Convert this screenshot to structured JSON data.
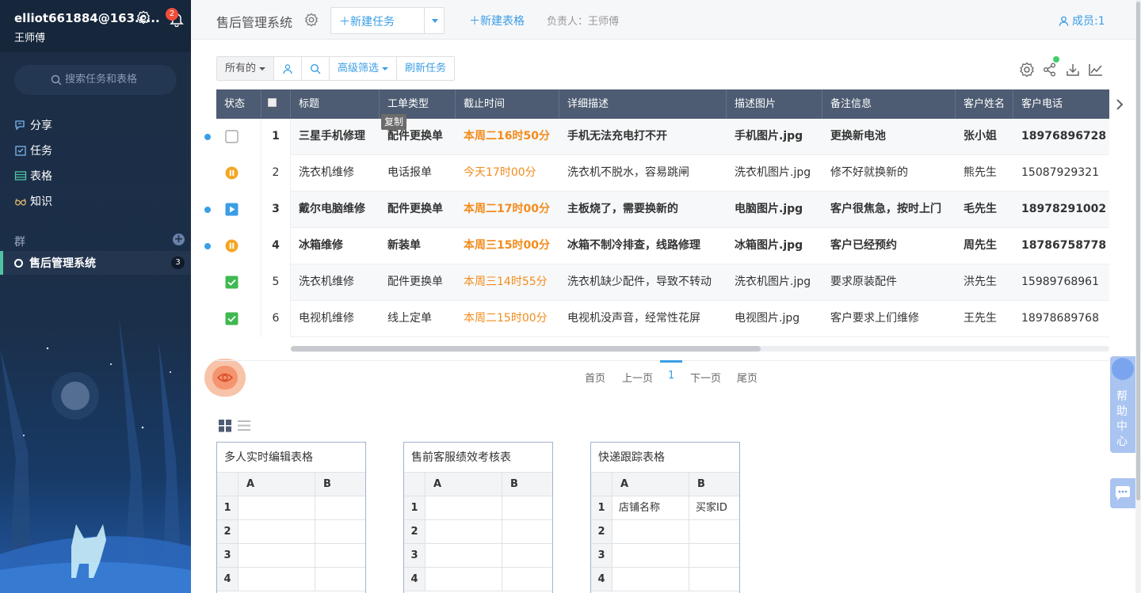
{
  "user": {
    "email": "elliot661884@163.c...",
    "name": "王师傅",
    "notifications": "2"
  },
  "sidebar": {
    "search_placeholder": "搜索任务和表格",
    "nav": [
      {
        "label": "分享",
        "icon": "share-chat-icon"
      },
      {
        "label": "任务",
        "icon": "task-check-icon"
      },
      {
        "label": "表格",
        "icon": "table-icon"
      },
      {
        "label": "知识",
        "icon": "glasses-icon"
      }
    ],
    "group_label": "群",
    "group_item": {
      "label": "售后管理系统",
      "count": "3"
    }
  },
  "header": {
    "title": "售后管理系统",
    "new_task": "新建任务",
    "new_table": "新建表格",
    "owner": "负责人：王师傅",
    "members": "成员:1"
  },
  "filter": {
    "all": "所有的",
    "advanced": "高级筛选",
    "refresh": "刷新任务"
  },
  "table": {
    "columns": [
      "状态",
      "标题",
      "工单类型",
      "截止时间",
      "详细描述",
      "描述图片",
      "备注信息",
      "客户姓名",
      "客户电话"
    ],
    "tooltip": "复制",
    "rows": [
      {
        "num": "1",
        "status": "unchecked",
        "title": "三星手机修理",
        "type": "配件更换单",
        "deadline": "本周二16时50分",
        "desc": "手机无法充电打不开",
        "image": "手机图片.jpg",
        "remark": "更换新电池",
        "customer": "张小姐",
        "phone": "18976896728",
        "bold": true,
        "unread": true
      },
      {
        "num": "2",
        "status": "paused",
        "title": "洗衣机维修",
        "type": "电话报单",
        "deadline": "今天17时00分",
        "desc": "洗衣机不脱水，容易跳闸",
        "image": "洗衣机图片.jpg",
        "remark": "修不好就换新的",
        "customer": "熊先生",
        "phone": "15087929321",
        "bold": false,
        "unread": false
      },
      {
        "num": "3",
        "status": "playing",
        "title": "戴尔电脑维修",
        "type": "配件更换单",
        "deadline": "本周二17时00分",
        "desc": "主板烧了，需要换新的",
        "image": "电脑图片.jpg",
        "remark": "客户很焦急，按时上门",
        "customer": "毛先生",
        "phone": "18978291002",
        "bold": true,
        "unread": true
      },
      {
        "num": "4",
        "status": "paused",
        "title": "冰箱维修",
        "type": "新装单",
        "deadline": "本周三15时00分",
        "desc": "冰箱不制冷排查，线路修理",
        "image": "冰箱图片.jpg",
        "remark": "客户已经预约",
        "customer": "周先生",
        "phone": "18786758778",
        "bold": true,
        "unread": true
      },
      {
        "num": "5",
        "status": "done",
        "title": "洗衣机维修",
        "type": "配件更换单",
        "deadline": "本周三14时55分",
        "desc": "洗衣机缺少配件，导致不转动",
        "image": "洗衣机图片.jpg",
        "remark": "要求原装配件",
        "customer": "洪先生",
        "phone": "15989768961",
        "bold": false,
        "unread": false
      },
      {
        "num": "6",
        "status": "done",
        "title": "电视机维修",
        "type": "线上定单",
        "deadline": "本周二15时00分",
        "desc": "电视机没声音，经常性花屏",
        "image": "电视图片.jpg",
        "remark": "客户要求上们维修",
        "customer": "王先生",
        "phone": "18978689768",
        "bold": false,
        "unread": false
      }
    ]
  },
  "pagination": {
    "first": "首页",
    "prev": "上一页",
    "current": "1",
    "next": "下一页",
    "last": "尾页"
  },
  "sheets": [
    {
      "title": "多人实时编辑表格",
      "col_a": "A",
      "col_b": "B",
      "rows": [
        [
          "1",
          "",
          ""
        ],
        [
          "2",
          "",
          ""
        ],
        [
          "3",
          "",
          ""
        ],
        [
          "4",
          "",
          ""
        ]
      ]
    },
    {
      "title": "售前客服绩效考核表",
      "col_a": "A",
      "col_b": "B",
      "rows": [
        [
          "1",
          "",
          ""
        ],
        [
          "2",
          "",
          ""
        ],
        [
          "3",
          "",
          ""
        ],
        [
          "4",
          "",
          ""
        ]
      ]
    },
    {
      "title": "快递跟踪表格",
      "col_a": "A",
      "col_b": "B",
      "rows": [
        [
          "1",
          "店铺名称",
          "买家ID"
        ],
        [
          "2",
          "",
          ""
        ],
        [
          "3",
          "",
          ""
        ],
        [
          "4",
          "",
          ""
        ]
      ]
    }
  ],
  "help": {
    "label": "帮助中心"
  },
  "colors": {
    "accent": "#3a9ee6",
    "deadline": "#f28c1c",
    "header_bg": "#4d5c72",
    "sidebar_bg": "#1c2d44",
    "paused": "#f5a623",
    "done": "#3fb950"
  }
}
